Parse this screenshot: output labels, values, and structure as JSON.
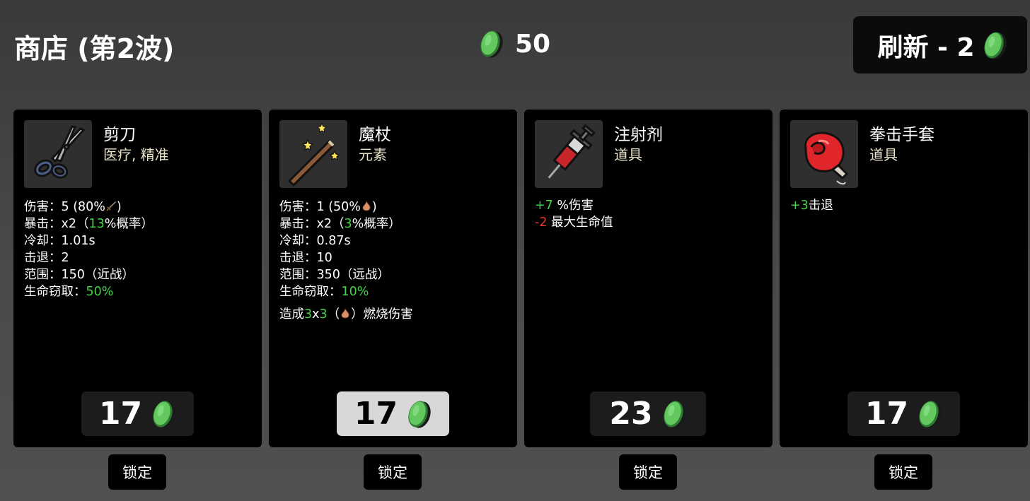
{
  "header": {
    "title": "商店 (第2波)",
    "materials": "50",
    "reroll_label": "刷新 - 2"
  },
  "colors": {
    "positive": "#44d24a",
    "negative": "#e8342e",
    "coin": "#5fc15a",
    "card_bg": "#000000"
  },
  "items": [
    {
      "name": "剪刀",
      "tags": "医疗, 精准",
      "icon": "scissors-icon",
      "stats": [
        {
          "label": "伤害：",
          "value": "5 (80%",
          "suffix": ")",
          "icon": "sword-icon"
        },
        {
          "label": "暴击：",
          "value": "x2（",
          "hl": "13",
          "suffix": "%概率）"
        },
        {
          "label": "冷却：",
          "value": "1.01s"
        },
        {
          "label": "击退：",
          "value": "2"
        },
        {
          "label": "范围：",
          "value": "150（近战）"
        },
        {
          "label": "生命窃取：",
          "hl": "50%"
        }
      ],
      "price": "17",
      "lock": "锁定"
    },
    {
      "name": "魔杖",
      "tags": "元素",
      "icon": "wand-icon",
      "stats": [
        {
          "label": "伤害：",
          "value": "1 (50%",
          "suffix": ")",
          "icon": "flame-icon"
        },
        {
          "label": "暴击：",
          "value": "x2（",
          "hl": "3",
          "suffix": "%概率）"
        },
        {
          "label": "冷却：",
          "value": "0.87s"
        },
        {
          "label": "击退：",
          "value": "10"
        },
        {
          "label": "范围：",
          "value": "350（远战）"
        },
        {
          "label": "生命窃取：",
          "hl": "10%"
        }
      ],
      "extra": {
        "a": "造成",
        "n1": "3",
        "x": "x",
        "n2": "3",
        "b": "（",
        "c": "）燃烧伤害"
      },
      "price": "17",
      "lock": "锁定"
    },
    {
      "name": "注射剂",
      "tags": "道具",
      "icon": "syringe-icon",
      "effects": [
        {
          "num": "+7",
          "text": " %伤害",
          "sign": "positive"
        },
        {
          "num": "-2",
          "text": " 最大生命值",
          "sign": "negative"
        }
      ],
      "price": "23",
      "lock": "锁定"
    },
    {
      "name": "拳击手套",
      "tags": "道具",
      "icon": "boxing-glove-icon",
      "effects": [
        {
          "num": "+3",
          "text": "击退",
          "sign": "positive"
        }
      ],
      "price": "17",
      "lock": "锁定"
    }
  ]
}
